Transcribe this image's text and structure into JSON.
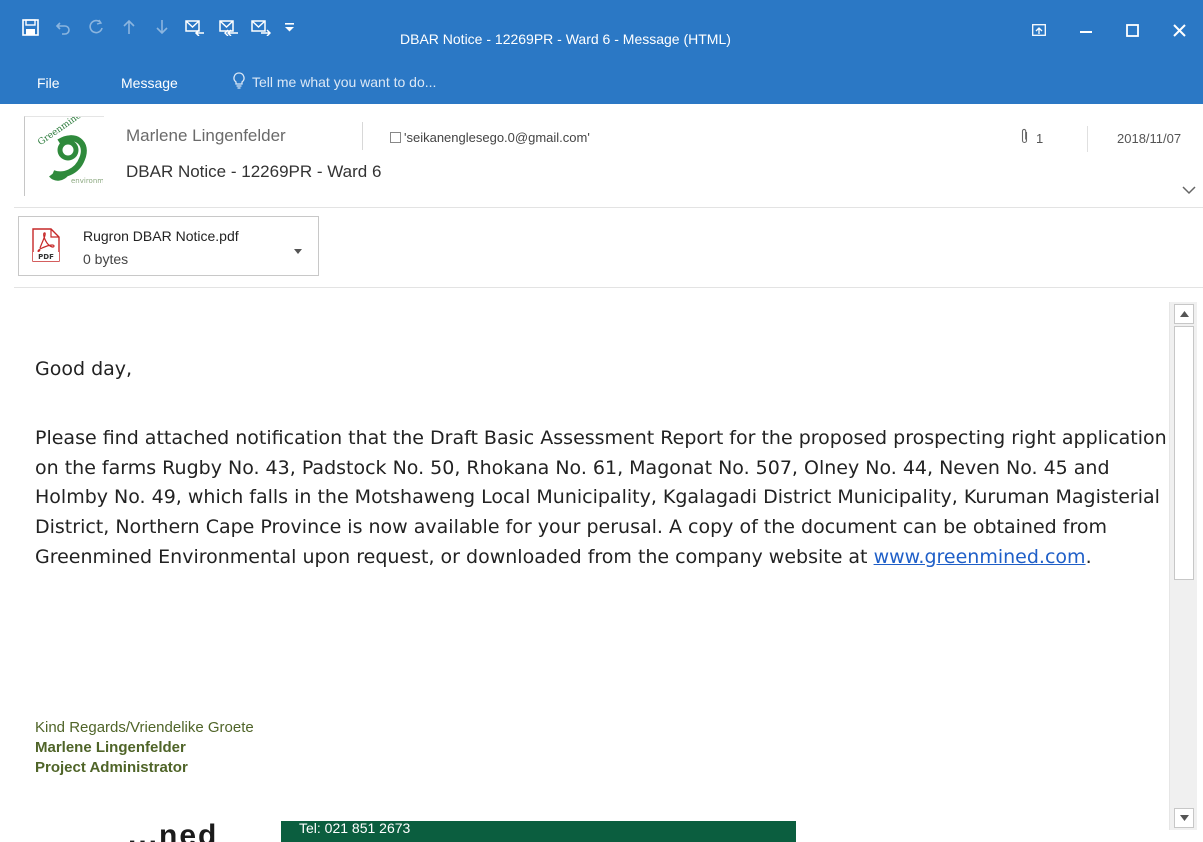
{
  "window": {
    "title": "DBAR Notice - 12269PR - Ward 6 - Message (HTML)",
    "accent": "#2b78c5"
  },
  "quick_access": [
    {
      "name": "save-icon"
    },
    {
      "name": "undo-icon"
    },
    {
      "name": "redo-icon"
    },
    {
      "name": "previous-item-icon"
    },
    {
      "name": "next-item-icon"
    },
    {
      "name": "reply-icon"
    },
    {
      "name": "reply-all-icon"
    },
    {
      "name": "forward-icon"
    },
    {
      "name": "customize-qat-icon"
    }
  ],
  "ribbon": {
    "tabs": [
      "File",
      "Message"
    ],
    "tell_me": "Tell me what you want to do..."
  },
  "header": {
    "sender": "Marlene Lingenfelder",
    "recipient": "'seikanenglesego.0@gmail.com'",
    "subject": "DBAR Notice - 12269PR - Ward 6",
    "attachment_count": "1",
    "date": "2018/11/07"
  },
  "attachment": {
    "name": "Rugron DBAR Notice.pdf",
    "size": "0 bytes",
    "icon": "pdf-icon",
    "icon_label": "PDF"
  },
  "body": {
    "greeting": "Good day,",
    "paragraph": "Please find attached notification that the Draft Basic Assessment Report for the proposed prospecting right application on the farms Rugby No. 43, Padstock No. 50, Rhokana No. 61, Magonat No. 507, Olney No. 44, Neven No. 45 and Holmby No. 49, which falls in the Motshaweng Local Municipality, Kgalagadi District Municipality, Kuruman Magisterial District, Northern Cape Province is now available for your perusal. A copy of the document can be obtained from Greenmined Environmental upon request, or downloaded from the company website at ",
    "link": "www.greenmined.com",
    "after_link": ".",
    "signature": {
      "closing": "Kind Regards/Vriendelike Groete",
      "name": "Marlene Lingenfelder",
      "role": "Project Administrator"
    },
    "logo_fragment": "...ned",
    "phone": "Tel: 021 851 2673"
  }
}
